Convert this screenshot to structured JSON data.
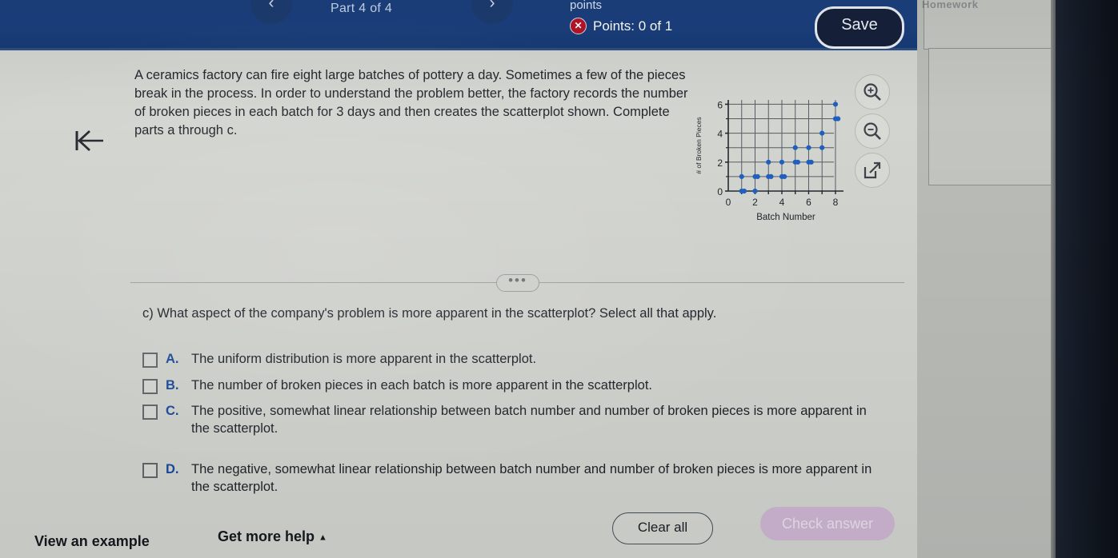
{
  "topbar": {
    "prev_icon": "chevron-left-icon",
    "next_icon": "chevron-right-icon",
    "part_label": "Part 4 of 4",
    "points_word": "points",
    "x_mark": "✕",
    "points_text": "Points: 0 of 1",
    "save_label": "Save",
    "blue": "#1b3f7d",
    "error_red": "#b5152a"
  },
  "content": {
    "back_icon": "skip-to-start-icon",
    "problem_text": "A ceramics factory can fire eight large batches of pottery a day. Sometimes a few of the pieces break in the process. In order to understand the problem better, the factory records the number of broken pieces in each batch for 3 days and then creates the scatterplot shown. Complete parts a through c.",
    "divider_dots": "•••"
  },
  "plot_tools": [
    {
      "name": "zoom-in-icon",
      "label": "Zoom in"
    },
    {
      "name": "zoom-out-icon",
      "label": "Zoom out"
    },
    {
      "name": "open-in-new-window-icon",
      "label": "Open in new window"
    }
  ],
  "question": {
    "prompt": "c) What aspect of the company's problem is more apparent in the scatterplot? Select all that apply.",
    "options": [
      {
        "letter": "A.",
        "text": "The uniform distribution is more apparent in the scatterplot.",
        "checked": false
      },
      {
        "letter": "B.",
        "text": "The number of broken pieces in each batch is more apparent in the scatterplot.",
        "checked": false
      },
      {
        "letter": "C.",
        "text": "The positive, somewhat linear relationship between batch number and number of broken pieces is more apparent in the scatterplot.",
        "checked": false
      },
      {
        "letter": "D.",
        "text": "The negative, somewhat linear relationship between batch number and number of broken pieces is more apparent in the scatterplot.",
        "checked": false
      }
    ]
  },
  "bottombar": {
    "view_example": "View an example",
    "get_more_help": "Get more help",
    "get_more_help_caret": "▲",
    "clear_all": "Clear all",
    "check_answer": "Check answer",
    "check_answer_color": "#cdb4d4"
  },
  "desktop": {
    "window_text": "Homework"
  },
  "chart_data": {
    "type": "scatter",
    "title": "",
    "xlabel": "Batch Number",
    "ylabel": "# of Broken Pieces",
    "xlim": [
      0,
      8.6
    ],
    "ylim": [
      0,
      6.3
    ],
    "xticks": [
      0,
      2,
      4,
      6,
      8
    ],
    "yticks": [
      0,
      2,
      4,
      6
    ],
    "grid": true,
    "point_color": "#1f5fbf",
    "points": [
      {
        "x": 1,
        "y": 0
      },
      {
        "x": 1,
        "y": 0
      },
      {
        "x": 1,
        "y": 1
      },
      {
        "x": 2,
        "y": 0
      },
      {
        "x": 2,
        "y": 1
      },
      {
        "x": 2,
        "y": 1
      },
      {
        "x": 3,
        "y": 1
      },
      {
        "x": 3,
        "y": 1
      },
      {
        "x": 3,
        "y": 2
      },
      {
        "x": 4,
        "y": 1
      },
      {
        "x": 4,
        "y": 1
      },
      {
        "x": 4,
        "y": 2
      },
      {
        "x": 5,
        "y": 2
      },
      {
        "x": 5,
        "y": 2
      },
      {
        "x": 5,
        "y": 3
      },
      {
        "x": 6,
        "y": 2
      },
      {
        "x": 6,
        "y": 2
      },
      {
        "x": 6,
        "y": 3
      },
      {
        "x": 7,
        "y": 3
      },
      {
        "x": 7,
        "y": 4
      },
      {
        "x": 8,
        "y": 5
      },
      {
        "x": 8,
        "y": 5
      },
      {
        "x": 8,
        "y": 6
      }
    ]
  }
}
